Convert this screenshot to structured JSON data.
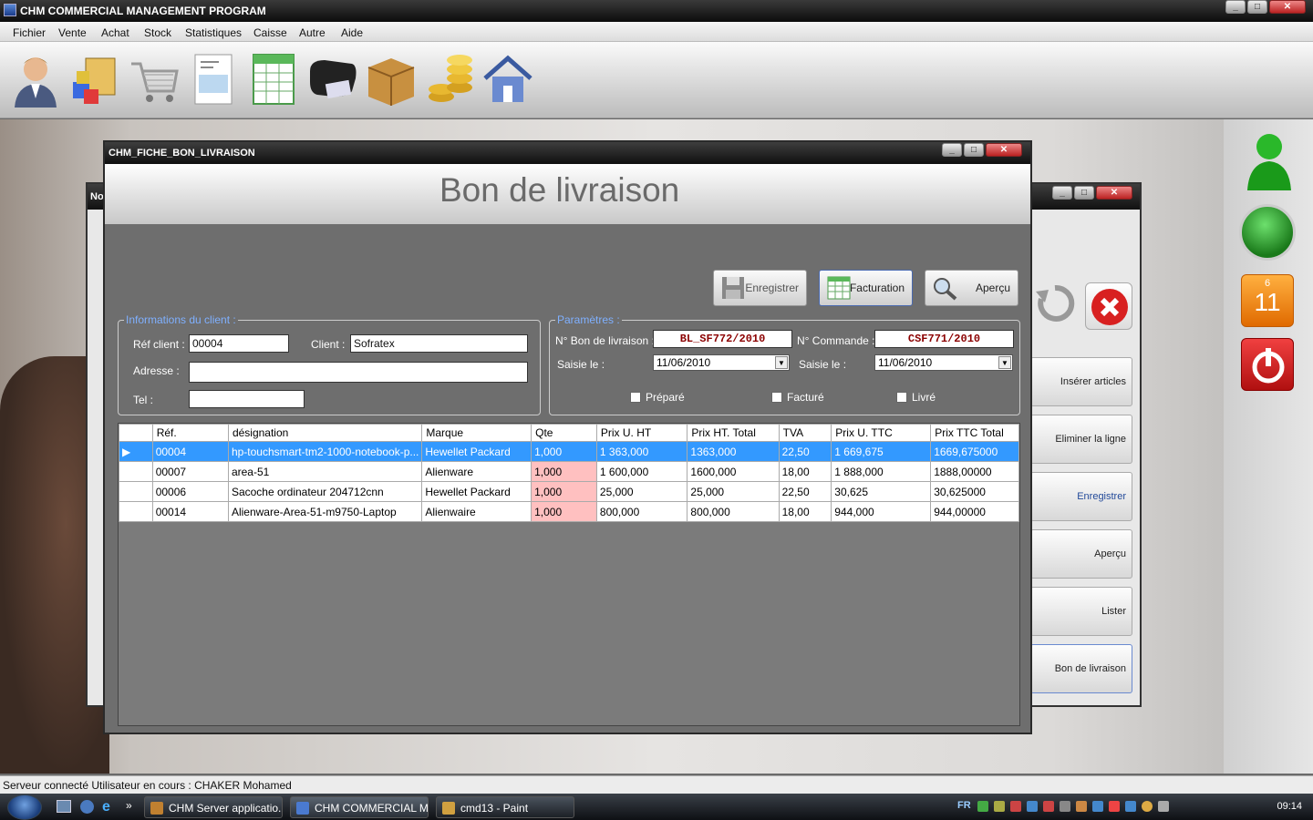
{
  "app": {
    "title": "CHM COMMERCIAL MANAGEMENT PROGRAM"
  },
  "menu": [
    "Fichier",
    "Vente",
    "Achat",
    "Stock",
    "Statistiques",
    "Caisse",
    "Autre",
    "Aide"
  ],
  "toolbar_icons": [
    "user-icon",
    "boxes-icon",
    "cart-icon",
    "invoice-icon",
    "spreadsheet-icon",
    "wallet-icon",
    "package-icon",
    "coins-icon",
    "house-icon"
  ],
  "back_window": {
    "title": "No",
    "buttons": [
      "Insérer articles",
      "Eliminer la ligne",
      "Enregistrer",
      "Aperçu",
      "Lister",
      "Bon de livraison"
    ]
  },
  "sidebar": {
    "calendar_month": "6",
    "calendar_day": "11"
  },
  "window": {
    "title": "CHM_FICHE_BON_LIVRAISON",
    "heading": "Bon de livraison",
    "actions": {
      "save": "Enregistrer",
      "invoice": "Facturation",
      "preview": "Aperçu"
    }
  },
  "client": {
    "legend": "Informations du client :",
    "ref_label": "Réf client :",
    "ref_value": "00004",
    "client_label": "Client :",
    "client_value": "Sofratex",
    "address_label": "Adresse :",
    "address_value": "",
    "tel_label": "Tel :",
    "tel_value": ""
  },
  "params": {
    "legend": "Paramètres :",
    "bl_label": "N° Bon de livraison :",
    "bl_value": "BL_SF772/2010",
    "cmd_label": "N° Commande :",
    "cmd_value": "CSF771/2010",
    "date1_label": "Saisie le :",
    "date1_value": "11/06/2010",
    "date2_label": "Saisie le :",
    "date2_value": "11/06/2010",
    "prepared": "Préparé",
    "invoiced": "Facturé",
    "delivered": "Livré"
  },
  "grid": {
    "columns": [
      "Réf.",
      "désignation",
      "Marque",
      "Qte",
      "Prix U. HT",
      "Prix HT. Total",
      "TVA",
      "Prix U. TTC",
      "Prix TTC Total"
    ],
    "rows": [
      [
        "00004",
        "hp-touchsmart-tm2-1000-notebook-p...",
        "Hewellet Packard",
        "1,000",
        "1 363,000",
        "1363,000",
        "22,50",
        "1 669,675",
        "1669,675000"
      ],
      [
        "00007",
        "area-51",
        "Alienware",
        "1,000",
        "1 600,000",
        "1600,000",
        "18,00",
        "1 888,000",
        "1888,00000"
      ],
      [
        "00006",
        "Sacoche ordinateur 204712cnn",
        "Hewellet Packard",
        "1,000",
        "25,000",
        "25,000",
        "22,50",
        "30,625",
        "30,625000"
      ],
      [
        "00014",
        "Alienware-Area-51-m9750-Laptop",
        "Alienwaire",
        "1,000",
        "800,000",
        "800,000",
        "18,00",
        "944,000",
        "944,00000"
      ]
    ]
  },
  "status": {
    "text": "Serveur connecté   Utilisateur en cours : CHAKER Mohamed"
  },
  "taskbar": {
    "tasks": [
      "CHM Server applicatio...",
      "CHM COMMERCIAL M...",
      "cmd13 - Paint"
    ],
    "lang": "FR",
    "clock": "09:14"
  }
}
